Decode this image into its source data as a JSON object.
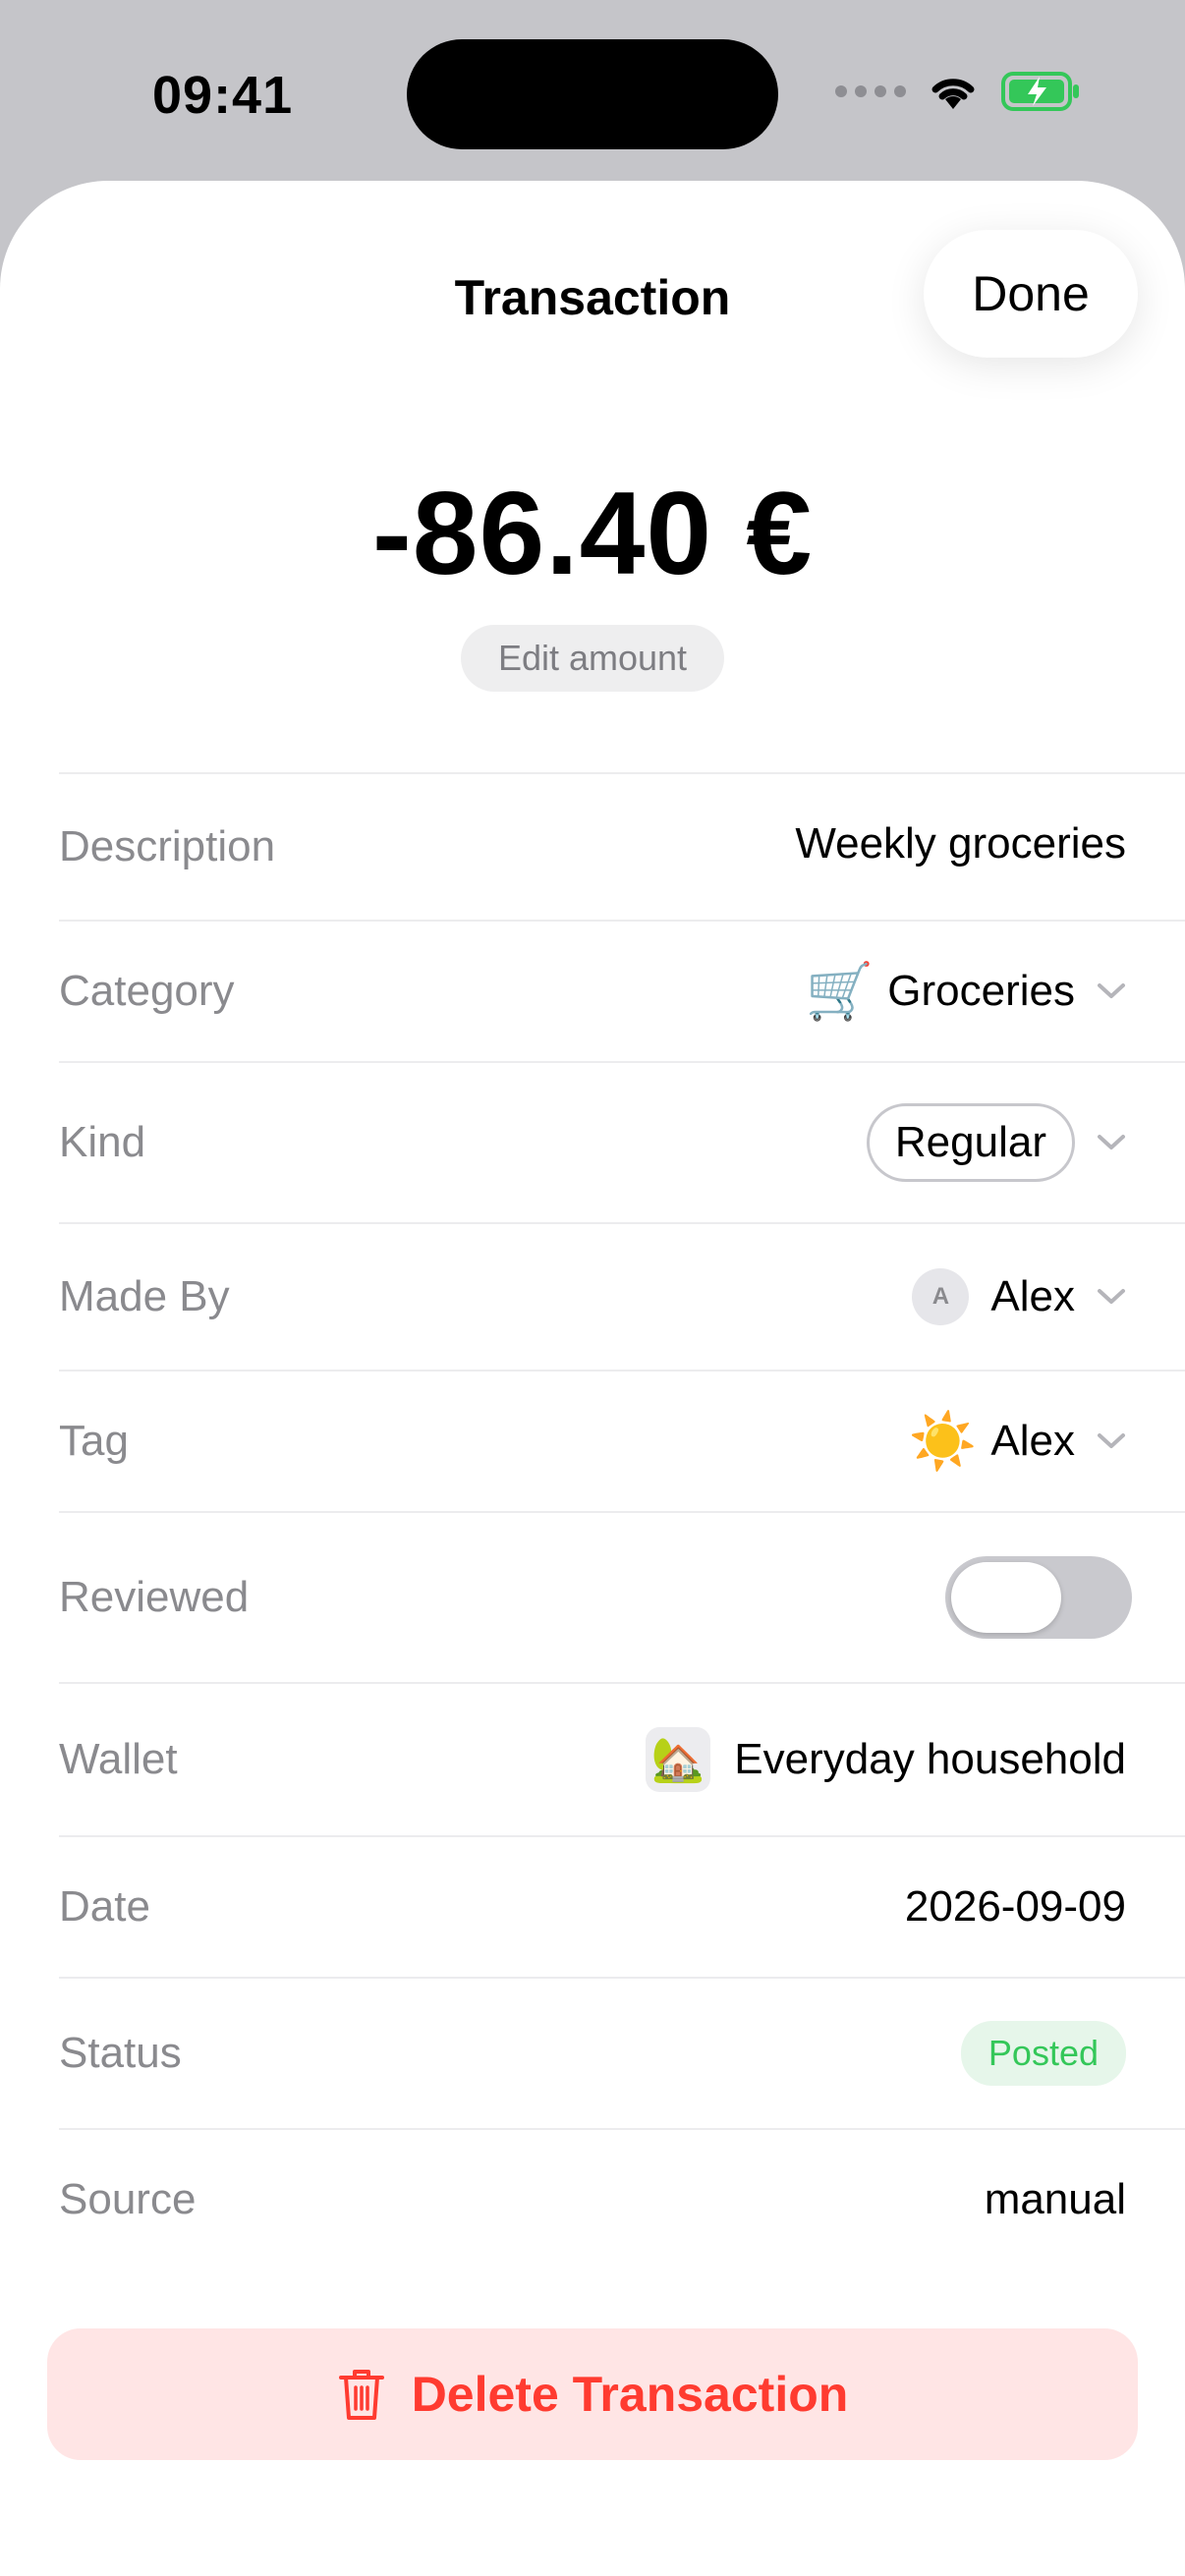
{
  "status_bar": {
    "time": "09:41"
  },
  "nav": {
    "title": "Transaction",
    "done_label": "Done"
  },
  "amount": {
    "value": "-86.40 €",
    "edit_label": "Edit amount"
  },
  "fields": {
    "description": {
      "label": "Description",
      "value": "Weekly groceries"
    },
    "category": {
      "label": "Category",
      "emoji": "🛒",
      "value": "Groceries"
    },
    "kind": {
      "label": "Kind",
      "value": "Regular"
    },
    "made_by": {
      "label": "Made By",
      "initial": "A",
      "value": "Alex"
    },
    "tag": {
      "label": "Tag",
      "emoji": "☀️",
      "value": "Alex"
    },
    "reviewed": {
      "label": "Reviewed",
      "on": false
    },
    "wallet": {
      "label": "Wallet",
      "emoji": "🏡",
      "value": "Everyday household"
    },
    "date": {
      "label": "Date",
      "value": "2026-09-09"
    },
    "status": {
      "label": "Status",
      "value": "Posted"
    },
    "source": {
      "label": "Source",
      "value": "manual"
    }
  },
  "delete": {
    "label": "Delete Transaction"
  },
  "colors": {
    "danger": "#ff3b30",
    "success": "#34c759",
    "battery": "#34c759"
  }
}
